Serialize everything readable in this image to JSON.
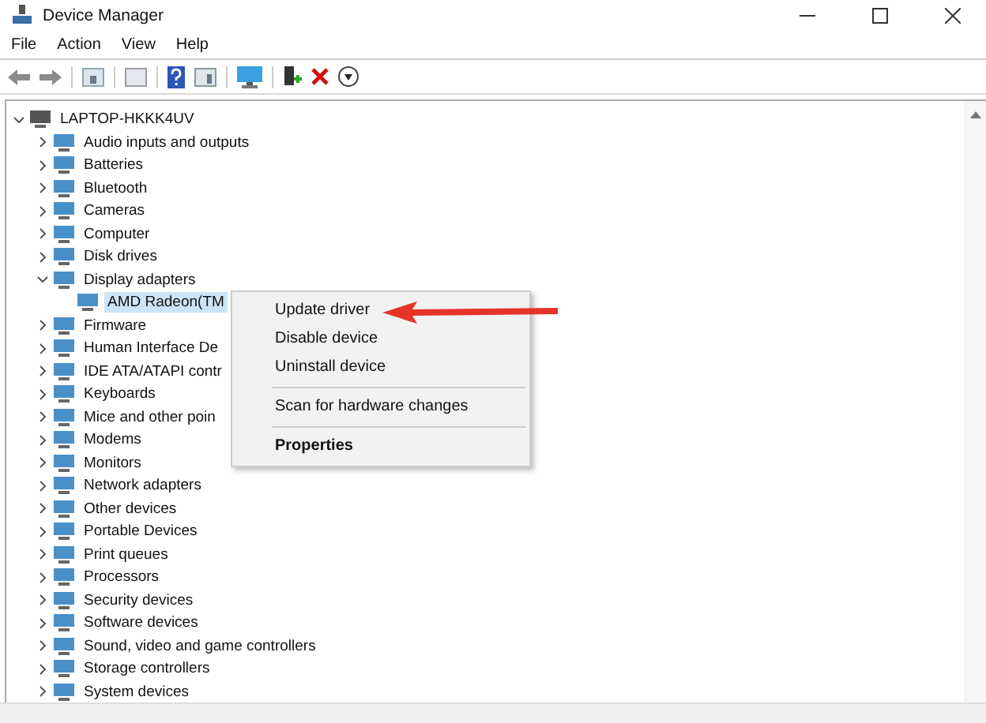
{
  "window": {
    "title": "Device Manager"
  },
  "menu_bar": [
    "File",
    "Action",
    "View",
    "Help"
  ],
  "tree": {
    "label": "LAPTOP-HKKK4UV",
    "expanded": true,
    "selected": false,
    "children": [
      {
        "label": "Audio inputs and outputs",
        "expanded": false,
        "selected": false
      },
      {
        "label": "Batteries",
        "expanded": false,
        "selected": false
      },
      {
        "label": "Bluetooth",
        "expanded": false,
        "selected": false
      },
      {
        "label": "Cameras",
        "expanded": false,
        "selected": false
      },
      {
        "label": "Computer",
        "expanded": false,
        "selected": false
      },
      {
        "label": "Disk drives",
        "expanded": false,
        "selected": false
      },
      {
        "label": "Display adapters",
        "expanded": true,
        "selected": false,
        "children": [
          {
            "label": "AMD Radeon(TM",
            "selected": true
          }
        ]
      },
      {
        "label": "Firmware",
        "expanded": false,
        "selected": false
      },
      {
        "label": "Human Interface De",
        "expanded": false,
        "selected": false
      },
      {
        "label": "IDE ATA/ATAPI contr",
        "expanded": false,
        "selected": false
      },
      {
        "label": "Keyboards",
        "expanded": false,
        "selected": false
      },
      {
        "label": "Mice and other poin",
        "expanded": false,
        "selected": false
      },
      {
        "label": "Modems",
        "expanded": false,
        "selected": false
      },
      {
        "label": "Monitors",
        "expanded": false,
        "selected": false
      },
      {
        "label": "Network adapters",
        "expanded": false,
        "selected": false
      },
      {
        "label": "Other devices",
        "expanded": false,
        "selected": false
      },
      {
        "label": "Portable Devices",
        "expanded": false,
        "selected": false
      },
      {
        "label": "Print queues",
        "expanded": false,
        "selected": false
      },
      {
        "label": "Processors",
        "expanded": false,
        "selected": false
      },
      {
        "label": "Security devices",
        "expanded": false,
        "selected": false
      },
      {
        "label": "Software devices",
        "expanded": false,
        "selected": false
      },
      {
        "label": "Sound, video and game controllers",
        "expanded": false,
        "selected": false
      },
      {
        "label": "Storage controllers",
        "expanded": false,
        "selected": false
      },
      {
        "label": "System devices",
        "expanded": false,
        "selected": false
      }
    ]
  },
  "context_menu": [
    {
      "kind": "item",
      "label": "Update driver",
      "bold": false
    },
    {
      "kind": "item",
      "label": "Disable device",
      "bold": false
    },
    {
      "kind": "item",
      "label": "Uninstall device",
      "bold": false
    },
    {
      "kind": "separator"
    },
    {
      "kind": "item",
      "label": "Scan for hardware changes",
      "bold": false
    },
    {
      "kind": "separator"
    },
    {
      "kind": "item",
      "label": "Properties",
      "bold": true
    }
  ]
}
